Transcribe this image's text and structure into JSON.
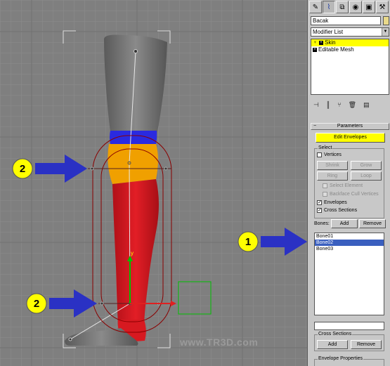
{
  "viewport": {
    "watermark": "www.TR3D.com",
    "callouts": [
      {
        "number": "2"
      },
      {
        "number": "2"
      },
      {
        "number": "1"
      }
    ],
    "gizmo_axis_label": "y",
    "colors": {
      "background": "#7f7f7f",
      "grid": "#8c8c8c",
      "mesh_grey": "#6e6e6e",
      "skin_red": "#d71920",
      "skin_orange": "#f0a000",
      "skin_blue": "#2a2ae0",
      "callout_yellow": "#ffff00",
      "arrow_blue": "#2a31c4"
    }
  },
  "panel": {
    "tabs": [
      {
        "icon": "create-icon"
      },
      {
        "icon": "modify-icon"
      },
      {
        "icon": "hierarchy-icon"
      },
      {
        "icon": "motion-icon"
      },
      {
        "icon": "display-icon"
      },
      {
        "icon": "utilities-icon"
      }
    ],
    "object_name": "Bacak",
    "object_color": "#e9d98a",
    "modifier_list_label": "Modifier List",
    "stack": [
      {
        "label": "Skin",
        "selected": true
      },
      {
        "label": "Editable Mesh",
        "selected": false
      }
    ],
    "parameters": {
      "title": "Parameters",
      "edit_envelopes": "Edit Envelopes",
      "select_group": "Select",
      "vertices": "Vertices",
      "shrink": "Shrink",
      "grow": "Grow",
      "ring": "Ring",
      "loop": "Loop",
      "select_element": "Select Element",
      "backface_cull": "Backface Cull Vertices",
      "envelopes": "Envelopes",
      "cross_sections": "Cross Sections",
      "bones_label": "Bones:",
      "add": "Add",
      "remove": "Remove",
      "bones": [
        "Bone01",
        "Bone02",
        "Bone03"
      ],
      "selected_bone": "Bone02",
      "cross_sections_group": "Cross Sections",
      "cs_add": "Add",
      "cs_remove": "Remove",
      "envelope_properties": "Envelope Properties"
    }
  }
}
